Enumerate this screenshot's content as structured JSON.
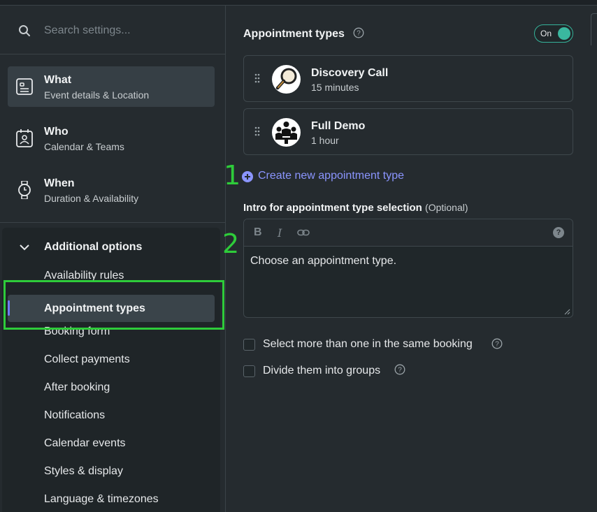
{
  "search": {
    "placeholder": "Search settings..."
  },
  "nav": [
    {
      "title": "What",
      "subtitle": "Event details & Location"
    },
    {
      "title": "Who",
      "subtitle": "Calendar & Teams"
    },
    {
      "title": "When",
      "subtitle": "Duration & Availability"
    }
  ],
  "additional": {
    "title": "Additional options",
    "items": [
      "Availability rules",
      "Appointment types",
      "Booking form",
      "Collect payments",
      "After booking",
      "Notifications",
      "Calendar events",
      "Styles & display",
      "Language & timezones"
    ]
  },
  "annotations": {
    "one": "1",
    "two": "2"
  },
  "main": {
    "section_title": "Appointment types",
    "toggle_label": "On",
    "cards": [
      {
        "title": "Discovery Call",
        "subtitle": "15 minutes",
        "icon": "magnifier-avatar"
      },
      {
        "title": "Full Demo",
        "subtitle": "1 hour",
        "icon": "team-avatar"
      }
    ],
    "create_label": "Create new appointment type",
    "intro_label": "Intro for appointment type selection",
    "intro_optional": "(Optional)",
    "toolbar": {
      "bold": "B",
      "italic": "I",
      "help": "?"
    },
    "intro_text": "Choose an appointment type.",
    "checkboxes": [
      "Select more than one in the same booking",
      "Divide them into groups"
    ]
  },
  "colors": {
    "accent": "#8b95ff",
    "toggle": "#3ab79f",
    "annotation": "#2ecc3a"
  }
}
